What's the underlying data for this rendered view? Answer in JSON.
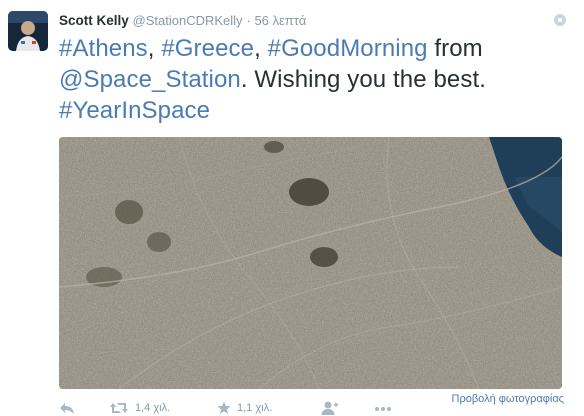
{
  "tweet": {
    "author_name": "Scott Kelly",
    "author_handle": "@StationCDRKelly",
    "separator": "·",
    "timestamp": "56 λεπτά",
    "text_parts": {
      "hashtag_athens": "#Athens",
      "comma1": ", ",
      "hashtag_greece": "#Greece",
      "comma2": ", ",
      "hashtag_goodmorning": "#GoodMorning",
      "from": " from ",
      "mention_space_station": "@Space_Station",
      "wishing": ". Wishing you the best. ",
      "hashtag_yearinspace": "#YearInSpace"
    },
    "photo_view_link": "Προβολή φωτογραφίας"
  },
  "actions": {
    "retweet_count": "1,4 χιλ.",
    "favorite_count": "1,1 χιλ."
  },
  "icons": {
    "reply": "reply-icon",
    "retweet": "retweet-icon",
    "favorite": "star-icon",
    "follow": "add-user-icon",
    "more": "more-dots-icon",
    "verified": "verified-badge-icon"
  },
  "colors": {
    "link": "#4a7cb3",
    "muted": "#8899a6",
    "text": "#292f33"
  }
}
